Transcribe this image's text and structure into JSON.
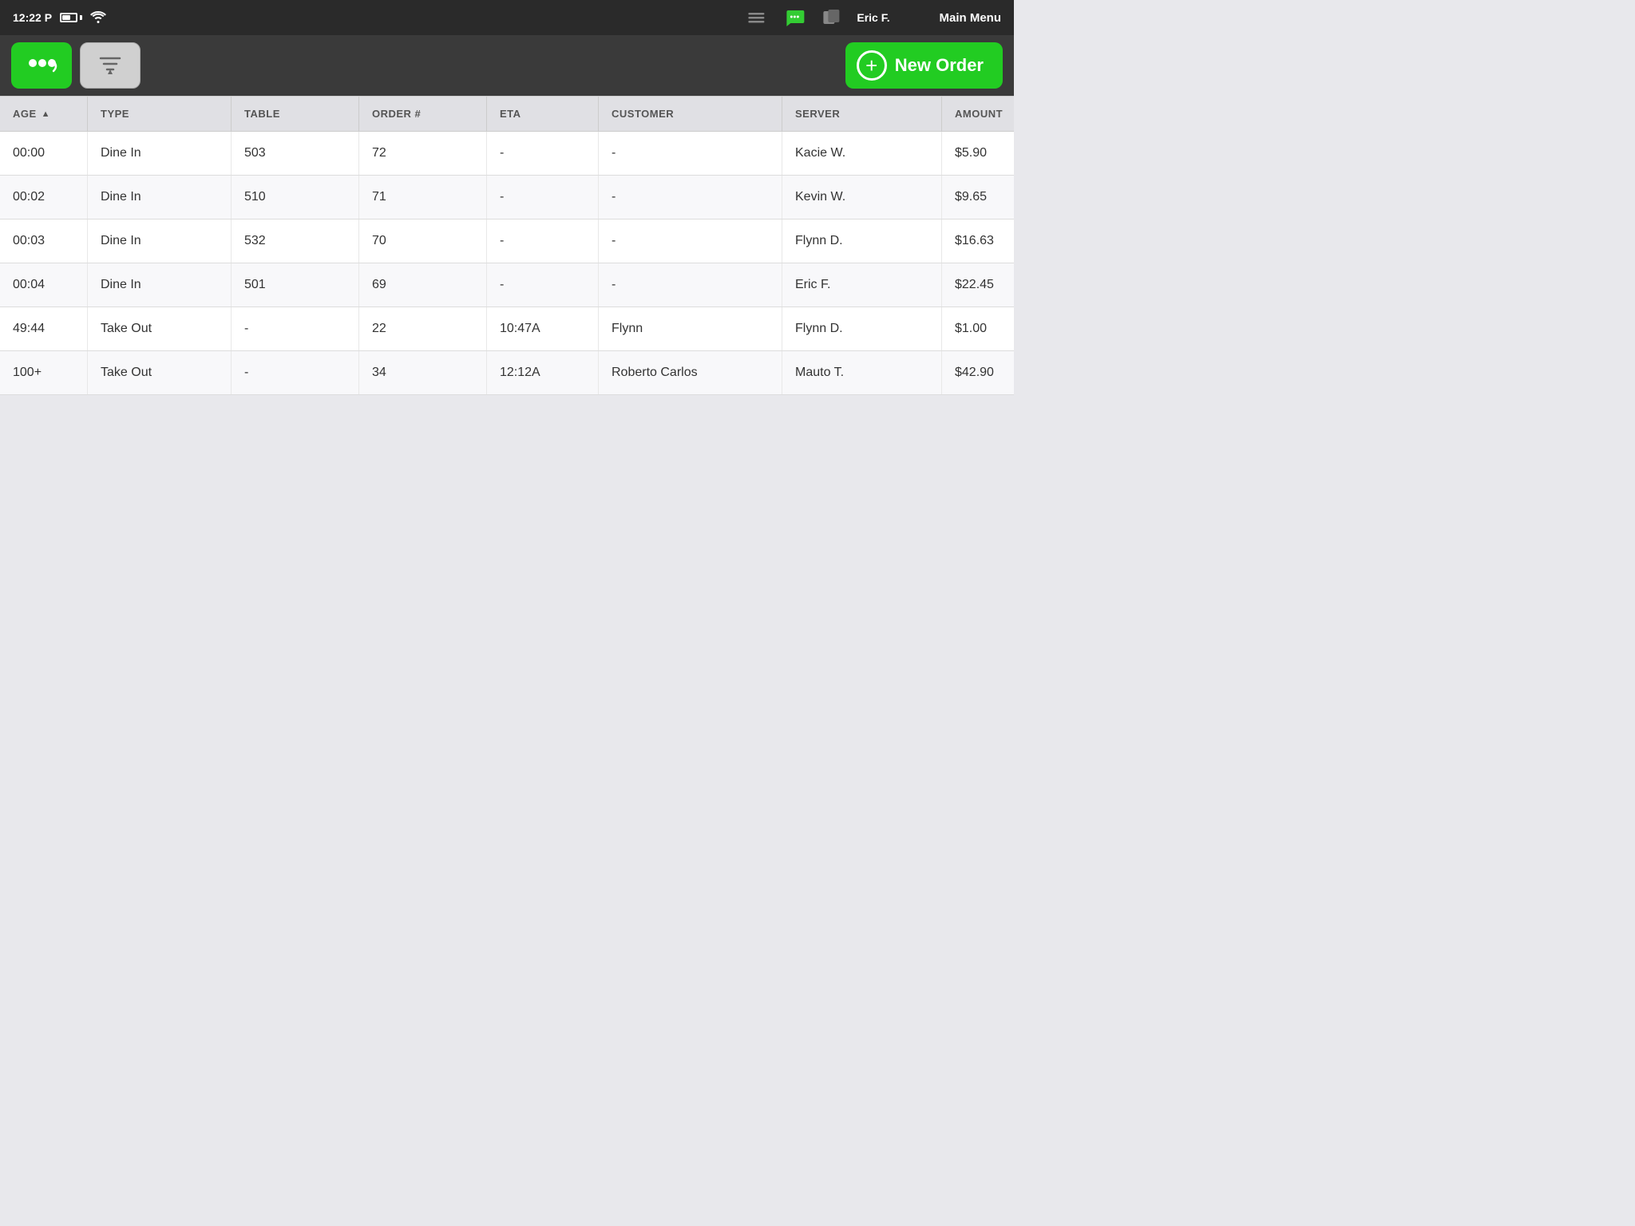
{
  "statusBar": {
    "time": "12:22 P",
    "mainMenu": "Main Menu",
    "user": "Eric F."
  },
  "toolbar": {
    "newOrderLabel": "New Order",
    "filterLabel": "Filter"
  },
  "table": {
    "columns": [
      {
        "key": "age",
        "label": "AGE",
        "sortable": true
      },
      {
        "key": "type",
        "label": "TYPE",
        "sortable": false
      },
      {
        "key": "table",
        "label": "TABLE",
        "sortable": false
      },
      {
        "key": "orderNum",
        "label": "ORDER #",
        "sortable": false
      },
      {
        "key": "eta",
        "label": "ETA",
        "sortable": false
      },
      {
        "key": "customer",
        "label": "CUSTOMER",
        "sortable": false
      },
      {
        "key": "server",
        "label": "SERVER",
        "sortable": false
      },
      {
        "key": "amount",
        "label": "AMOUNT",
        "sortable": false
      }
    ],
    "rows": [
      {
        "age": "00:00",
        "type": "Dine In",
        "table": "503",
        "orderNum": "72",
        "eta": "-",
        "customer": "-",
        "server": "Kacie W.",
        "amount": "$5.90"
      },
      {
        "age": "00:02",
        "type": "Dine In",
        "table": "510",
        "orderNum": "71",
        "eta": "-",
        "customer": "-",
        "server": "Kevin W.",
        "amount": "$9.65"
      },
      {
        "age": "00:03",
        "type": "Dine In",
        "table": "532",
        "orderNum": "70",
        "eta": "-",
        "customer": "-",
        "server": "Flynn D.",
        "amount": "$16.63"
      },
      {
        "age": "00:04",
        "type": "Dine In",
        "table": "501",
        "orderNum": "69",
        "eta": "-",
        "customer": "-",
        "server": "Eric F.",
        "amount": "$22.45"
      },
      {
        "age": "49:44",
        "type": "Take Out",
        "table": "-",
        "orderNum": "22",
        "eta": "10:47A",
        "customer": "Flynn",
        "server": "Flynn D.",
        "amount": "$1.00"
      },
      {
        "age": "100+",
        "type": "Take Out",
        "table": "-",
        "orderNum": "34",
        "eta": "12:12A",
        "customer": "Roberto Carlos",
        "server": "Mauto T.",
        "amount": "$42.90"
      }
    ]
  }
}
